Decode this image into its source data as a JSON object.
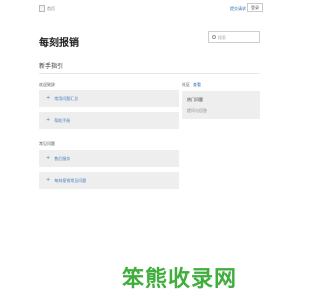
{
  "header": {
    "logo_alt": "首页",
    "link_label": "提交请求",
    "button_label": "登录"
  },
  "page": {
    "title": "每刻报销",
    "subtitle": "新手指引"
  },
  "search": {
    "placeholder": "搜索"
  },
  "sections": [
    {
      "label": "欢迎致辞",
      "items": [
        "常用问题汇总",
        "帮助手册"
      ]
    },
    {
      "label": "常见问题",
      "items": [
        "售后服务",
        "每刻报销常见问题"
      ]
    }
  ],
  "community": {
    "title": "社区",
    "more": "查看",
    "items": [
      "热门问题",
      "提问与回答"
    ]
  },
  "watermark": "笨熊收录网",
  "colors": {
    "accent": "#4a7fc0",
    "card_bg": "#eeeeee",
    "watermark": "#3fae3c"
  }
}
